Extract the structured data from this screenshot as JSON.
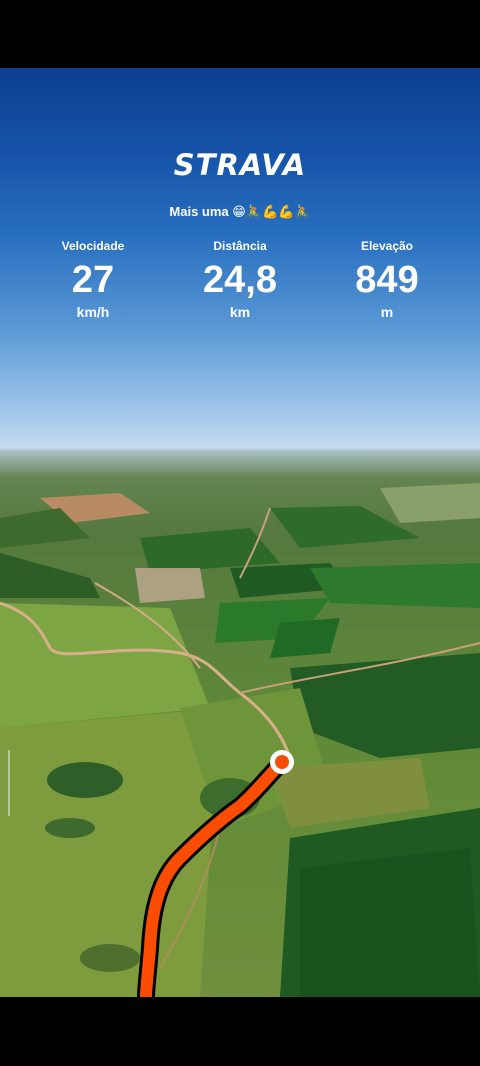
{
  "app": {
    "brand": "STRAVA"
  },
  "activity": {
    "title": "Mais uma 😁🚴💪💪🚴"
  },
  "stats": [
    {
      "label": "Velocidade",
      "value": "27",
      "unit": "km/h"
    },
    {
      "label": "Distância",
      "value": "24,8",
      "unit": "km"
    },
    {
      "label": "Elevação",
      "value": "849",
      "unit": "m"
    }
  ],
  "colors": {
    "route": "#fc4c02",
    "route_outline": "#000000",
    "marker_fill": "#ffffff",
    "marker_ring": "#fc4c02"
  }
}
